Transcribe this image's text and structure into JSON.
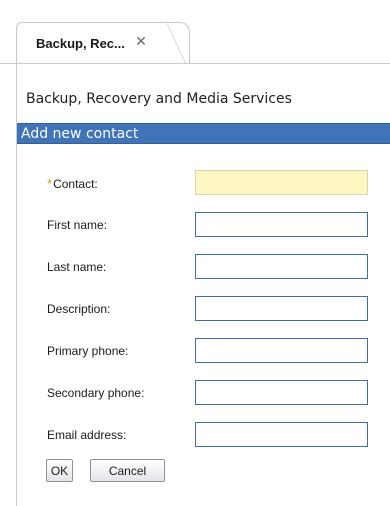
{
  "tab": {
    "label": "Backup, Rec...",
    "close_glyph": "✕"
  },
  "page": {
    "heading": "Backup, Recovery and Media Services"
  },
  "section": {
    "title": "Add new contact"
  },
  "form": {
    "required_marker": "*",
    "fields": [
      {
        "label": "Contact:",
        "value": "",
        "required": true
      },
      {
        "label": "First name:",
        "value": ""
      },
      {
        "label": "Last name:",
        "value": ""
      },
      {
        "label": "Description:",
        "value": ""
      },
      {
        "label": "Primary phone:",
        "value": ""
      },
      {
        "label": "Secondary phone:",
        "value": ""
      },
      {
        "label": "Email address:",
        "value": ""
      }
    ]
  },
  "buttons": {
    "ok": "OK",
    "cancel": "Cancel"
  },
  "colors": {
    "section_bar": "#3f74b8",
    "required_field": "#fff7c2",
    "input_border": "#3f6fa8"
  }
}
